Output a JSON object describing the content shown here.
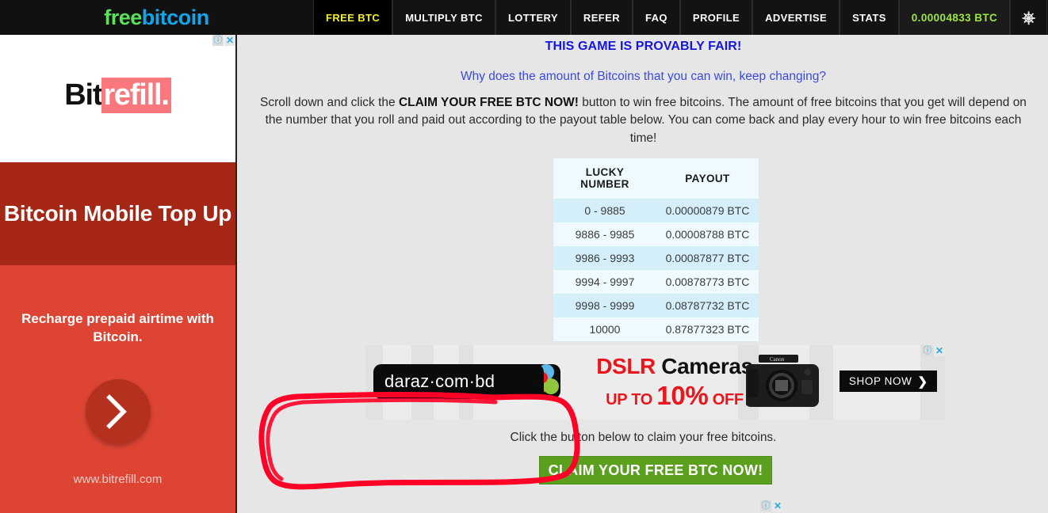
{
  "site": {
    "logo_free": "free",
    "logo_bitcoin": "bitcoin"
  },
  "nav": {
    "items": [
      {
        "label": "FREE BTC",
        "state": "active",
        "name": "nav-free-btc"
      },
      {
        "label": "MULTIPLY BTC",
        "state": "normal",
        "name": "nav-multiply-btc"
      },
      {
        "label": "LOTTERY",
        "state": "normal",
        "name": "nav-lottery"
      },
      {
        "label": "REFER",
        "state": "normal",
        "name": "nav-refer"
      },
      {
        "label": "FAQ",
        "state": "normal",
        "name": "nav-faq"
      },
      {
        "label": "PROFILE",
        "state": "normal",
        "name": "nav-profile"
      },
      {
        "label": "ADVERTISE",
        "state": "normal",
        "name": "nav-advertise"
      },
      {
        "label": "STATS",
        "state": "normal",
        "name": "nav-stats"
      }
    ],
    "balance": "0.00004833 BTC",
    "logout_icon": "power-icon",
    "active_color": "#f5f02a",
    "balance_color": "#9ee53f"
  },
  "sidebar_ad": {
    "adchoices_info": "ⓘ",
    "adchoices_close": "✕",
    "brand_bit": "Bit",
    "brand_refill": "refill.",
    "headline": "Bitcoin Mobile Top Up",
    "subtext": "Recharge prepaid airtime with Bitcoin.",
    "cta_icon": "chevron-right-icon",
    "url": "www.bitrefill.com",
    "color_dark": "#a62716",
    "color_light": "#de4434",
    "color_accent": "#f9777d"
  },
  "main": {
    "heading_provably_fair": "THIS GAME IS PROVABLY FAIR!",
    "heading_why_changing": "Why does the amount of Bitcoins that you can win, keep changing?",
    "intro_part1": "Scroll down and click the ",
    "intro_bold": "CLAIM YOUR FREE BTC NOW!",
    "intro_part2": " button to win free bitcoins. The amount of free bitcoins that you get will depend on the number that you roll and paid out according to the payout table below. You can come back and play every hour to win free bitcoins each time!",
    "heading_color": "#1515e0",
    "link_color": "#3a4ae0"
  },
  "payout_table": {
    "headers": [
      "LUCKY NUMBER",
      "PAYOUT"
    ],
    "rows": [
      {
        "lucky": "0 - 9885",
        "payout": "0.00000879 BTC"
      },
      {
        "lucky": "9886 - 9985",
        "payout": "0.00008788 BTC"
      },
      {
        "lucky": "9986 - 9993",
        "payout": "0.00087877 BTC"
      },
      {
        "lucky": "9994 - 9997",
        "payout": "0.00878773 BTC"
      },
      {
        "lucky": "9998 - 9999",
        "payout": "0.08787732 BTC"
      },
      {
        "lucky": "10000",
        "payout": "0.87877323 BTC"
      }
    ],
    "row_color_odd": "#d4effa",
    "row_color_even": "#eefafd"
  },
  "banner_ad": {
    "adchoices_info": "ⓘ",
    "adchoices_close": "✕",
    "brand": "daraz·com·bd",
    "headline_red": "DSLR",
    "headline_black": "Cameras",
    "subline_prefix": "UP TO ",
    "subline_big": "10%",
    "subline_suffix": " OFF",
    "cta_label": "SHOP NOW",
    "cta_arrow": "❯",
    "product": "canon-dslr-camera-image",
    "red": "#e8161d"
  },
  "claim": {
    "caption": "Click the button below to claim your free bitcoins.",
    "button_label": "CLAIM YOUR FREE BTC NOW!",
    "button_color": "#5aa01e",
    "adchoices_info": "ⓘ",
    "adchoices_close": "✕"
  },
  "annotation": {
    "shape": "hand-drawn-red-oval-highlight",
    "color": "#ff0026"
  }
}
